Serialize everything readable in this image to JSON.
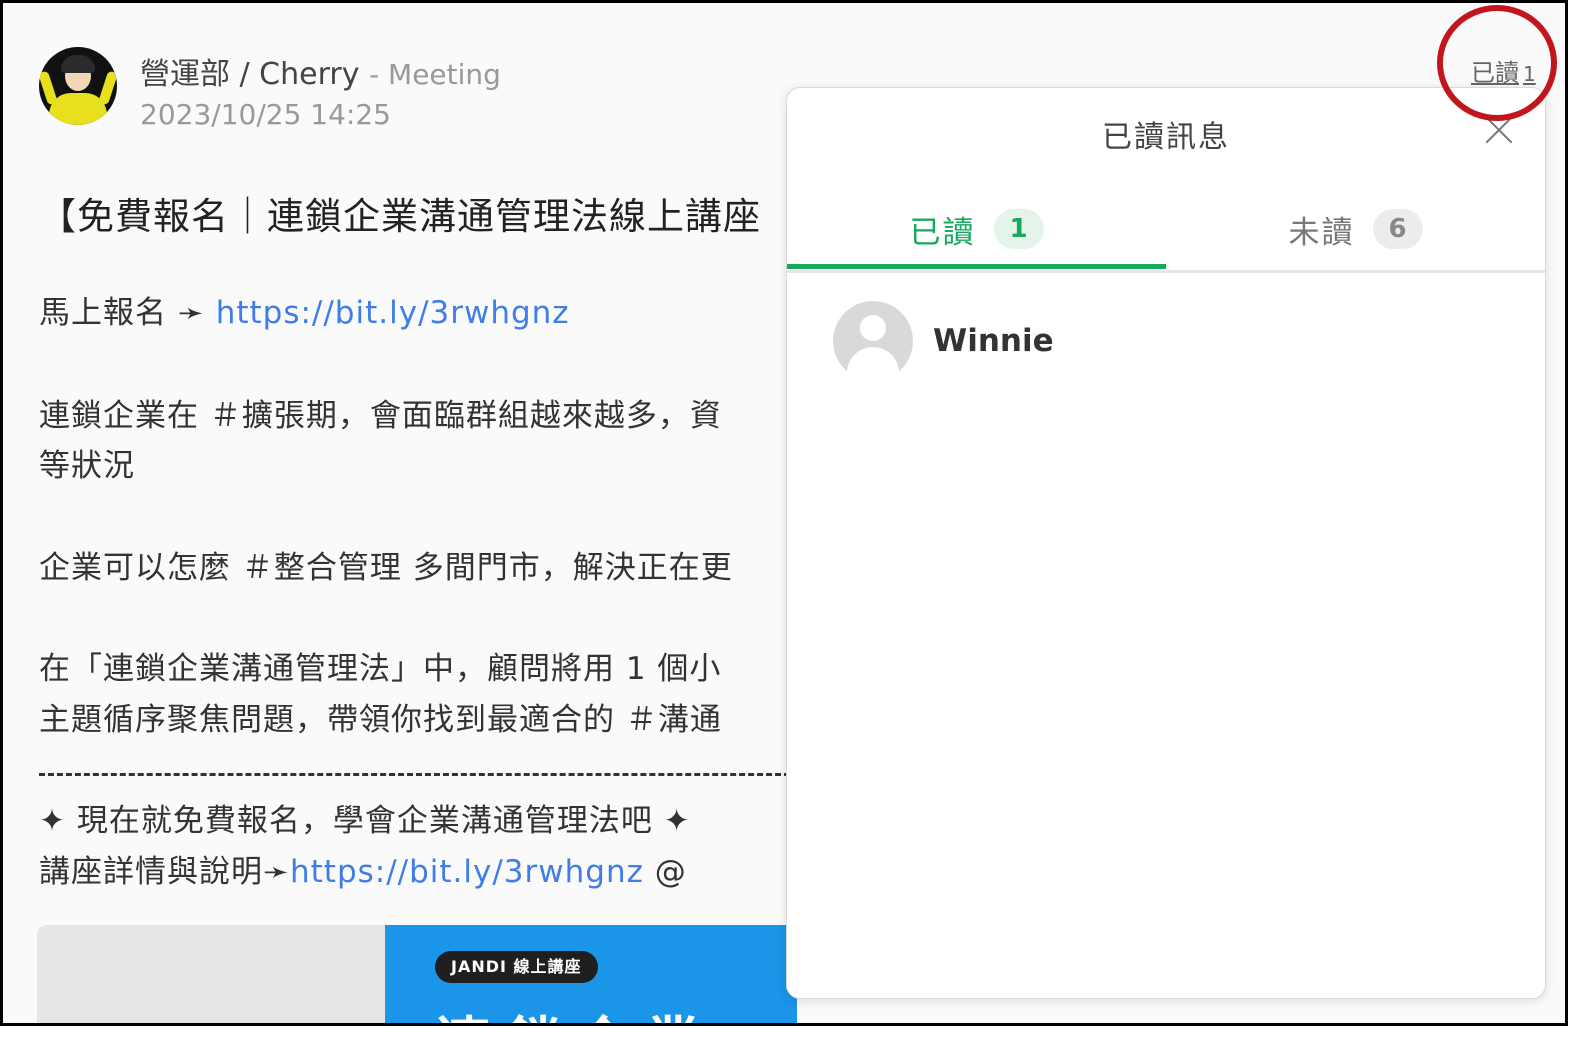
{
  "message": {
    "sender": "營運部 / Cherry",
    "topic": "- Meeting",
    "timestamp": "2023/10/25 14:25",
    "title": "【免費報名｜連鎖企業溝通管理法線上講座",
    "signup_prefix": "馬上報名 ➛ ",
    "signup_link": "https://bit.ly/3rwhgnz",
    "para1_line1": "連鎖企業在 ＃擴張期，會面臨群組越來越多，資",
    "para1_line2": "等狀況",
    "para2_line1": "企業可以怎麼 ＃整合管理 多間門市，解決正在更",
    "para3_line1": "在「連鎖企業溝通管理法」中，顧問將用 1 個小",
    "para3_line2": "主題循序聚焦問題，帶領你找到最適合的 ＃溝通",
    "cta_line": "✦ 現在就免費報名，學會企業溝通管理法吧 ✦",
    "details_prefix": "講座詳情與說明➛",
    "details_link": "https://bit.ly/3rwhgnz",
    "details_suffix": " @",
    "image_badge": "JANDI 線上講座",
    "image_big_text": "連鎖企業"
  },
  "read_indicator": {
    "label": "已讀",
    "count": "1"
  },
  "popup": {
    "title": "已讀訊息",
    "tabs": [
      {
        "label": "已讀",
        "count": "1",
        "active": true
      },
      {
        "label": "未讀",
        "count": "6",
        "active": false
      }
    ],
    "read_users": [
      {
        "name": "Winnie"
      }
    ]
  },
  "colors": {
    "accent_green": "#16a85d",
    "link_blue": "#3f7ee8",
    "highlight_red": "#c0161c"
  },
  "icons": {
    "close": "close-icon",
    "default_avatar": "user-placeholder-icon"
  }
}
